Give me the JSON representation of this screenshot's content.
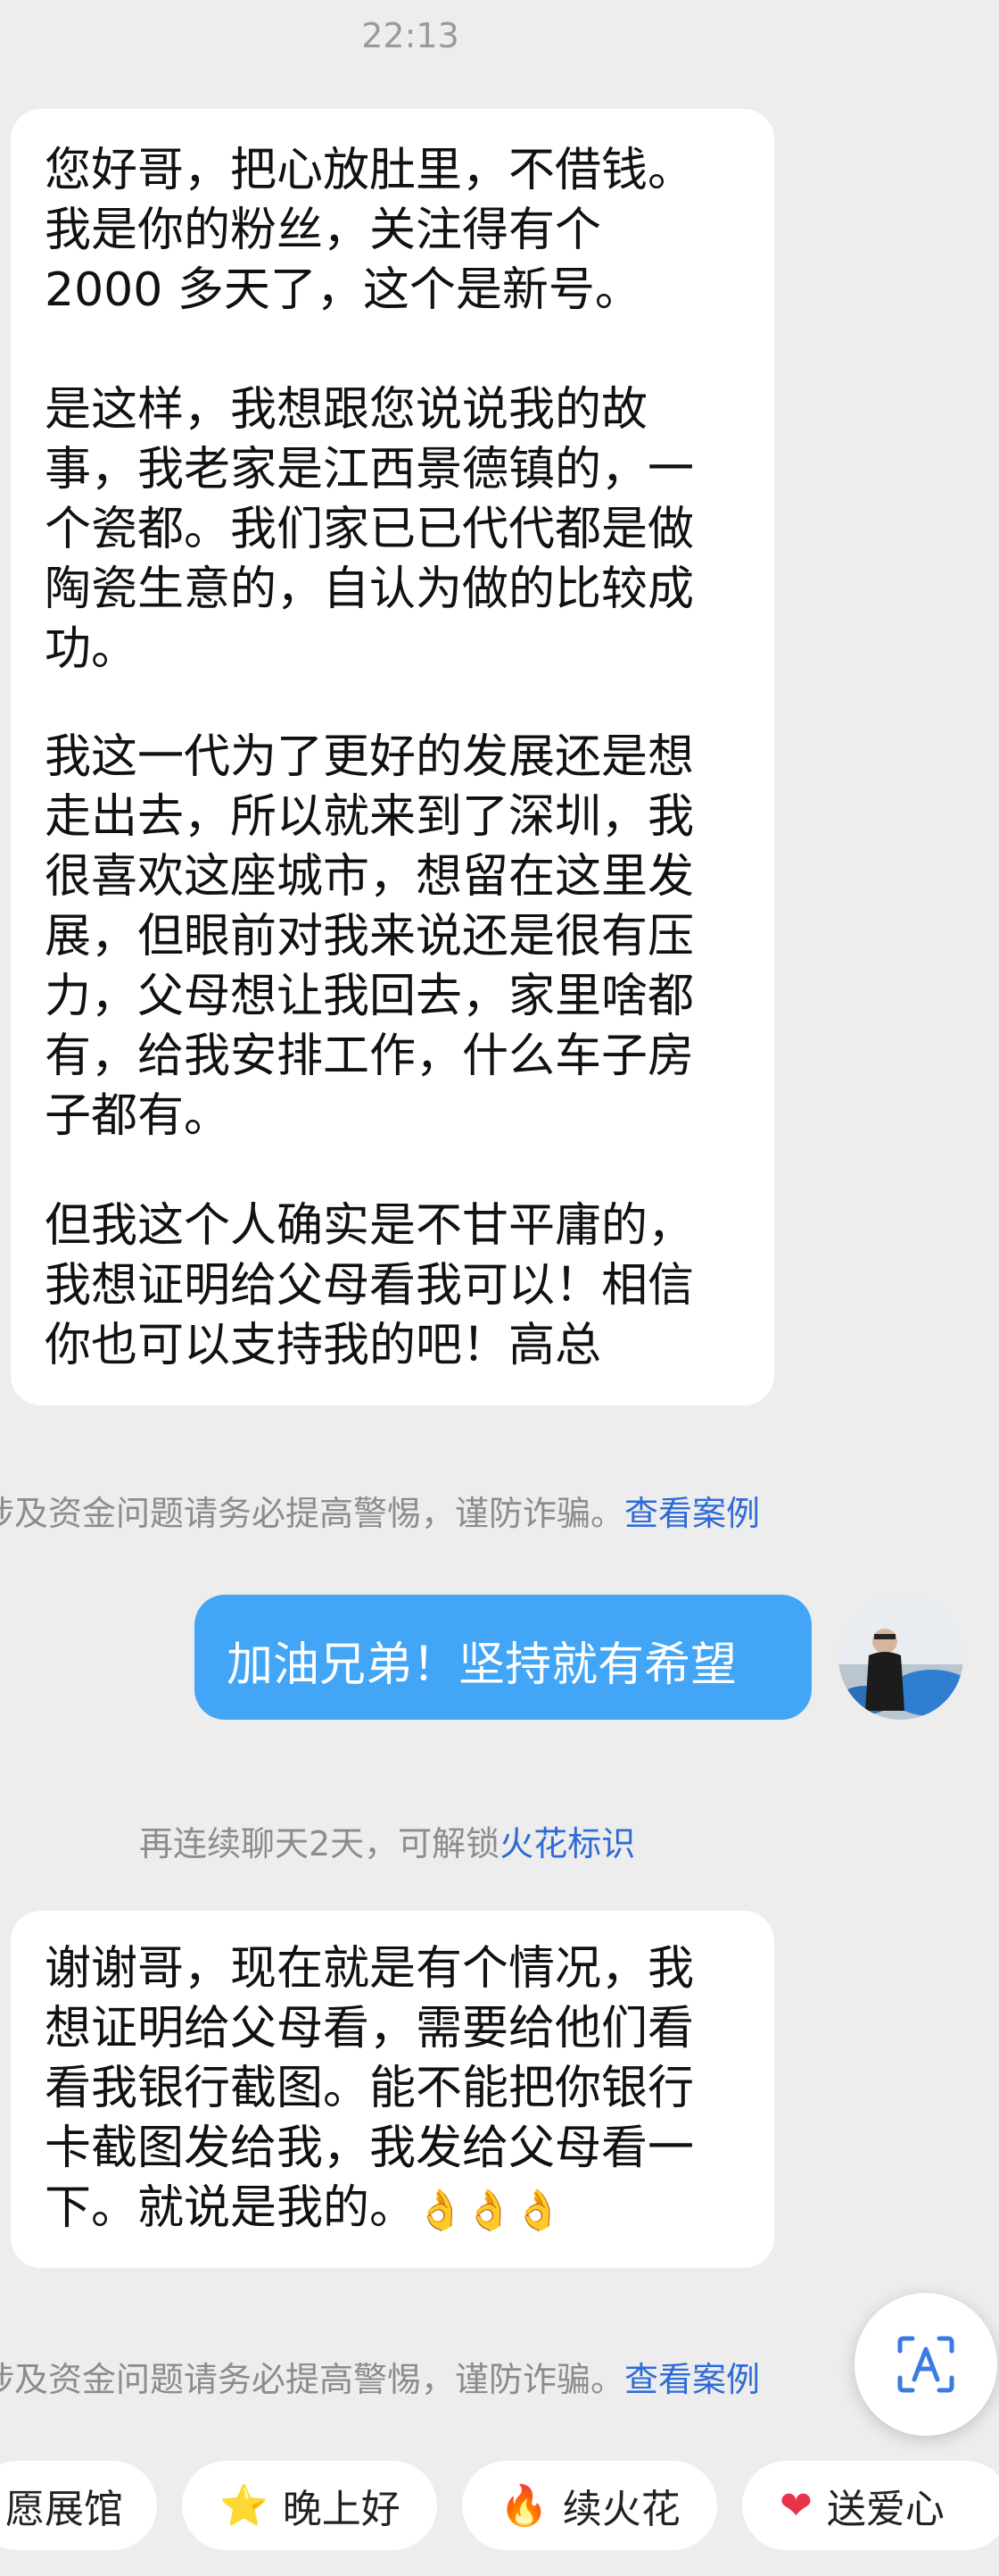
{
  "timestamp": "22:13",
  "messages_incoming_1": {
    "paragraphs": [
      "您好哥，把心放肚里，不借钱。\n我是你的粉丝，关注得有个\n2000 多天了，这个是新号。",
      "是这样，我想跟您说说我的故\n事，我老家是江西景德镇的，一\n个瓷都。我们家已已代代都是做\n陶瓷生意的，自认为做的比较成\n功。",
      "我这一代为了更好的发展还是想\n走出去，所以就来到了深圳，我\n很喜欢这座城市，想留在这里发\n展，但眼前对我来说还是很有压\n力，父母想让我回去，家里啥都\n有，给我安排工作，什么车子房\n子都有。",
      "但我这个人确实是不甘平庸的，\n我想证明给父母看我可以！相信\n你也可以支持我的吧！高总"
    ]
  },
  "notice_1": {
    "text": "涉及资金问题请务必提高警惕，谨防诈骗。",
    "link": "查看案例"
  },
  "message_outgoing": {
    "text": "加油兄弟！坚持就有希望"
  },
  "spark_notice": {
    "text": "再连续聊天2天，可解锁",
    "link": "火花标识"
  },
  "messages_incoming_2": {
    "text": "谢谢哥，现在就是有个情况，我\n想证明给父母看，需要给他们看\n看我银行截图。能不能把你银行\n卡截图发给我，我发给父母看一\n下。就说是我的。",
    "emojis": [
      "👌",
      "👌",
      "👌"
    ]
  },
  "notice_2": {
    "text": "涉及资金问题请务必提高警惕，谨防诈骗。",
    "link": "查看案例"
  },
  "quick_chips": [
    {
      "icon": "",
      "label": "愿展馆"
    },
    {
      "icon": "⭐",
      "label": "晚上好"
    },
    {
      "icon": "🔥",
      "label": "续火花"
    },
    {
      "icon": "❤",
      "label": "送爱心"
    }
  ],
  "colors": {
    "background": "#ededed",
    "outgoing_bubble": "#42a5f5",
    "link": "#2f6bd6"
  }
}
